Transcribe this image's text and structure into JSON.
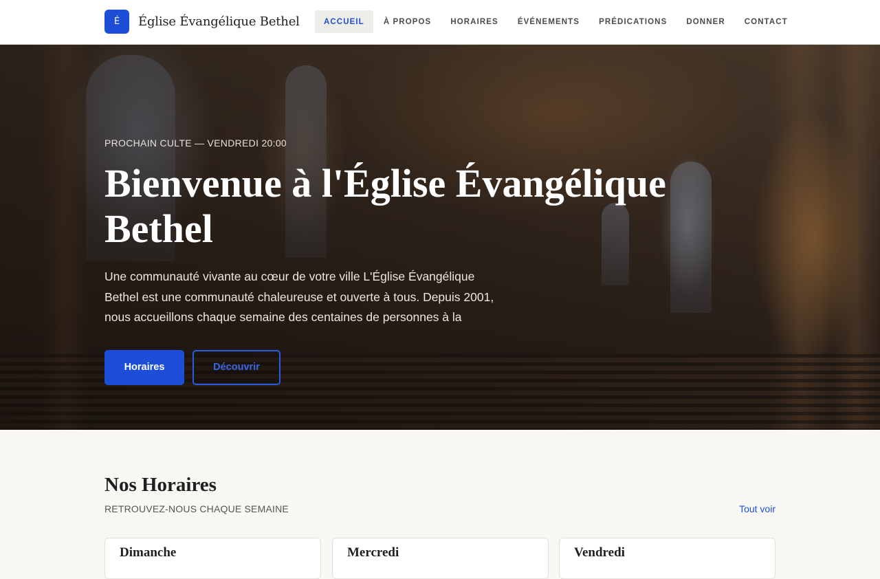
{
  "brand": {
    "logo_letter": "É",
    "name": "Église Évangélique Bethel",
    "accent": "#1d4ed8"
  },
  "nav": {
    "items": [
      {
        "label": "Accueil",
        "active": true
      },
      {
        "label": "À propos"
      },
      {
        "label": "Horaires"
      },
      {
        "label": "Événements"
      },
      {
        "label": "Prédications"
      },
      {
        "label": "Donner"
      },
      {
        "label": "Contact"
      }
    ]
  },
  "hero": {
    "eyebrow": "Prochain culte — Vendredi 20:00",
    "title": "Bienvenue à l'Église Évangélique Bethel",
    "text": "Une communauté vivante au cœur de votre ville L'Église Évangélique Bethel est une communauté chaleureuse et ouverte à tous. Depuis 2001, nous accueillons chaque semaine des centaines de personnes à la",
    "primary_button": "Horaires",
    "secondary_button": "Découvrir"
  },
  "schedule": {
    "title": "Nos Horaires",
    "subtitle": "Retrouvez-nous chaque semaine",
    "see_all": "Tout voir",
    "cards": [
      {
        "title": "Dimanche"
      },
      {
        "title": "Mercredi"
      },
      {
        "title": "Vendredi"
      }
    ]
  }
}
